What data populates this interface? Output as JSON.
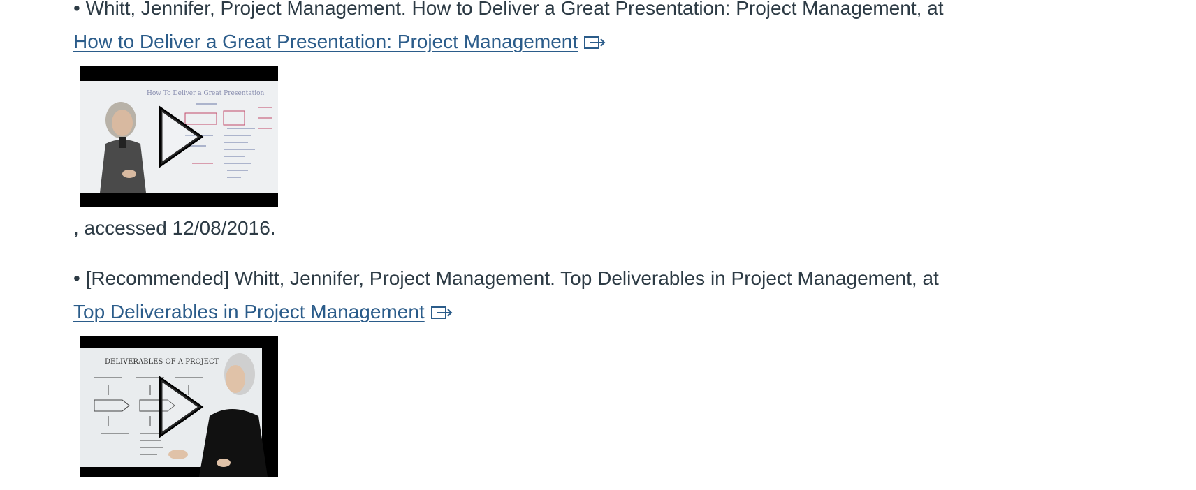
{
  "entries": [
    {
      "bullet": "•",
      "text": "Whitt, Jennifer, Project Management. How to Deliver a Great Presentation: Project Management, at",
      "link_label": "How to Deliver a Great Presentation: Project Management",
      "thumbnail_alt": "How to Deliver a Great Presentation video thumbnail",
      "board_title": "How To Deliver a Great Presentation",
      "suffix": ", accessed 12/08/2016."
    },
    {
      "bullet": "•",
      "text": "[Recommended] Whitt, Jennifer, Project Management. Top Deliverables in Project Management, at",
      "link_label": "Top Deliverables in Project Management",
      "thumbnail_alt": "Top Deliverables in Project Management video thumbnail",
      "board_title": "DELIVERABLES OF A PROJECT"
    }
  ],
  "icons": {
    "external_link": "external-link-icon",
    "play": "play-icon"
  },
  "colors": {
    "text": "#2d3b45",
    "link": "#2b5c8a"
  }
}
